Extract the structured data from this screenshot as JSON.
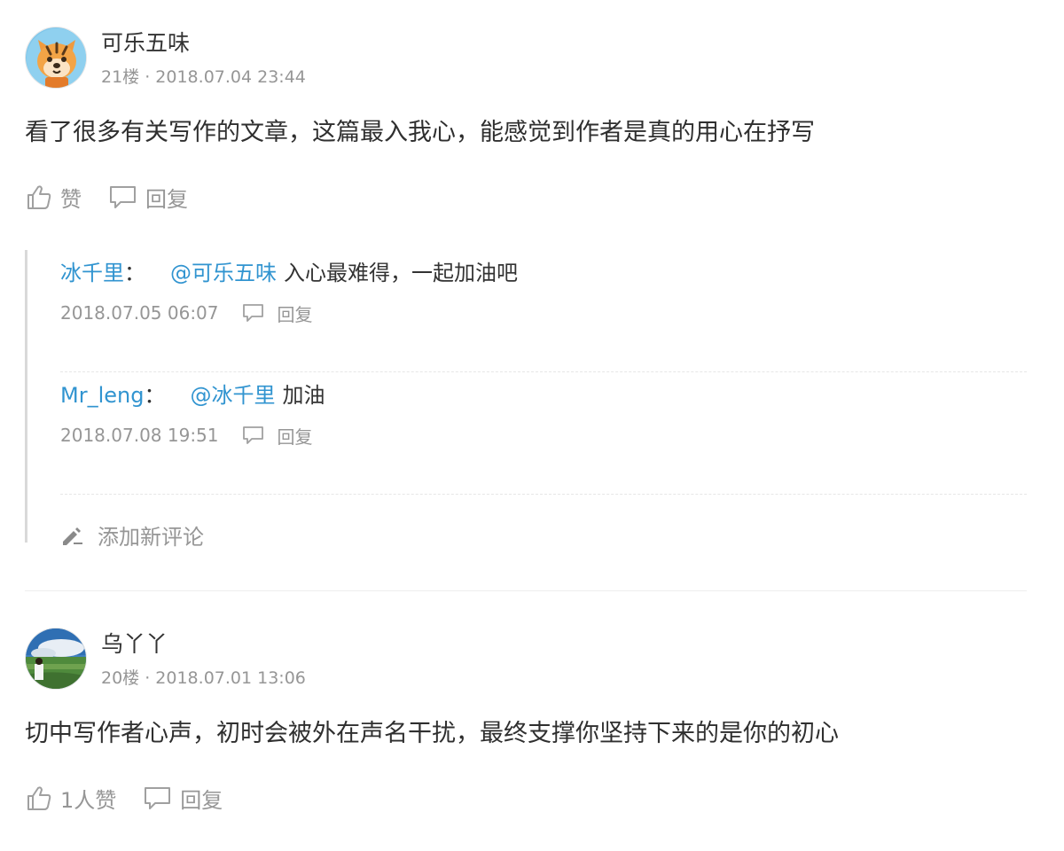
{
  "comments": [
    {
      "author": "可乐五味",
      "floor_meta": "21楼 · 2018.07.04 23:44",
      "text": "看了很多有关写作的文章，这篇最入我心，能感觉到作者是真的用心在抒写",
      "like_label": "赞",
      "reply_label": "回复",
      "avatar_icon": "tiger-avatar-icon"
    },
    {
      "author": "乌丫丫",
      "floor_meta": "20楼 · 2018.07.01 13:06",
      "text": "切中写作者心声，初时会被外在声名干扰，最终支撑你坚持下来的是你的初心",
      "like_label": "1人赞",
      "reply_label": "回复",
      "avatar_icon": "landscape-photo-avatar"
    }
  ],
  "sub_comments": [
    {
      "user": "冰千里",
      "sep": "：",
      "mention": "@可乐五味",
      "text": "入心最难得，一起加油吧",
      "time": "2018.07.05 06:07",
      "reply_label": "回复"
    },
    {
      "user": "Mr_leng",
      "sep": "：",
      "mention": "@冰千里",
      "text": "加油",
      "time": "2018.07.08 19:51",
      "reply_label": "回复"
    }
  ],
  "add_comment_label": "添加新评论",
  "colors": {
    "link_blue": "#3194d0",
    "muted_gray": "#969696",
    "text": "#333333",
    "thread_border": "#d9d9d9"
  }
}
